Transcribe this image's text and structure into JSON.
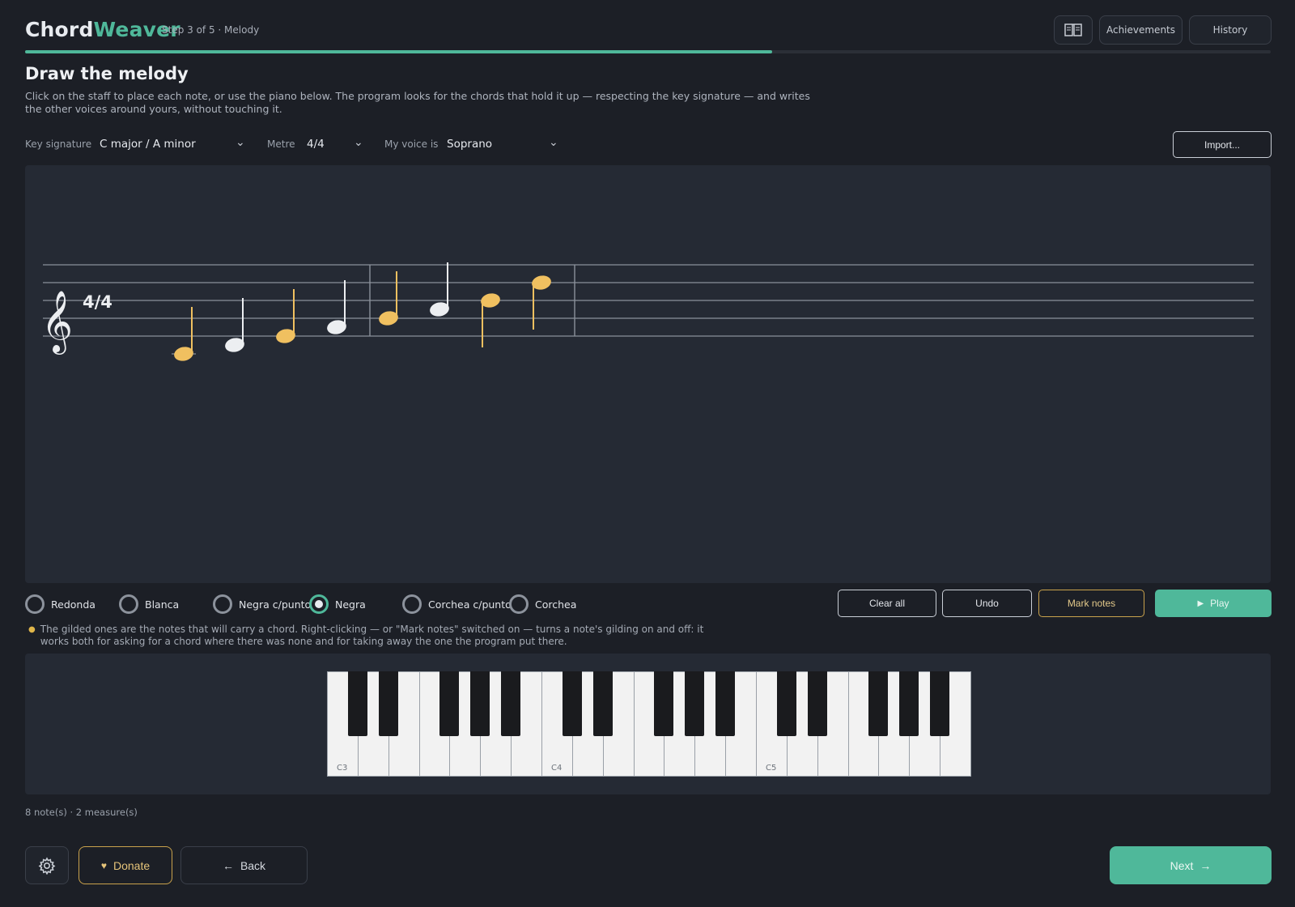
{
  "app": {
    "logo_part1": "Chord",
    "logo_part2": "Weaver",
    "step": "Step 3 of 5 · Melody",
    "progress": 0.6
  },
  "header": {
    "book_icon": "book-icon",
    "achievements_label": "Achievements",
    "history_label": "History"
  },
  "page": {
    "title": "Draw the melody",
    "description": "Click on the staff to place each note, or use the piano below. The program looks for the chords that hold it up — respecting the key signature — and writes the other voices around yours, without touching it."
  },
  "controls": {
    "key_label": "Key signature",
    "key_value": "C major / A minor",
    "metre_label": "Metre",
    "metre_value": "4/4",
    "voice_label": "My voice is",
    "voice_value": "Soprano",
    "import_label": "Import..."
  },
  "staff": {
    "time_signature": "4/4",
    "clef_glyph": "𝄞",
    "measures": 2,
    "notes": [
      {
        "pitch": "C4",
        "duration": "quarter",
        "gilded": true
      },
      {
        "pitch": "D4",
        "duration": "quarter",
        "gilded": false
      },
      {
        "pitch": "E4",
        "duration": "quarter",
        "gilded": true
      },
      {
        "pitch": "F4",
        "duration": "quarter",
        "gilded": false
      },
      {
        "pitch": "G4",
        "duration": "quarter",
        "gilded": true
      },
      {
        "pitch": "A4",
        "duration": "quarter",
        "gilded": false
      },
      {
        "pitch": "B4",
        "duration": "quarter",
        "gilded": true
      },
      {
        "pitch": "D5",
        "duration": "quarter",
        "gilded": true
      }
    ],
    "colors": {
      "gilded": "#f0c060",
      "plain": "#eceef1",
      "line": "#8b919b"
    }
  },
  "durations": [
    {
      "label": "Redonda",
      "selected": false
    },
    {
      "label": "Blanca",
      "selected": false
    },
    {
      "label": "Negra c/punto",
      "selected": false
    },
    {
      "label": "Negra",
      "selected": true
    },
    {
      "label": "Corchea c/punto",
      "selected": false
    },
    {
      "label": "Corchea",
      "selected": false
    }
  ],
  "actions": {
    "clear_label": "Clear all",
    "undo_label": "Undo",
    "mark_label": "Mark notes",
    "play_label": "Play"
  },
  "hint": "The gilded ones are the notes that will carry a chord. Right-clicking — or \"Mark notes\" switched on — turns a note's gilding on and off: it works both for asking for a chord where there was none and for taking away the one the program put there.",
  "piano": {
    "labels": {
      "C3": "C3",
      "C4": "C4",
      "C5": "C5"
    },
    "white_keys": 21
  },
  "status": "8 note(s) · 2 measure(s)",
  "footer": {
    "gear_icon": "gear-icon",
    "donate_label": "Donate",
    "back_label": "Back",
    "next_label": "Next"
  },
  "colors": {
    "accent": "#4fb89a",
    "gold": "#c9a24c",
    "background": "#1c1f26",
    "panel": "#252a34"
  }
}
